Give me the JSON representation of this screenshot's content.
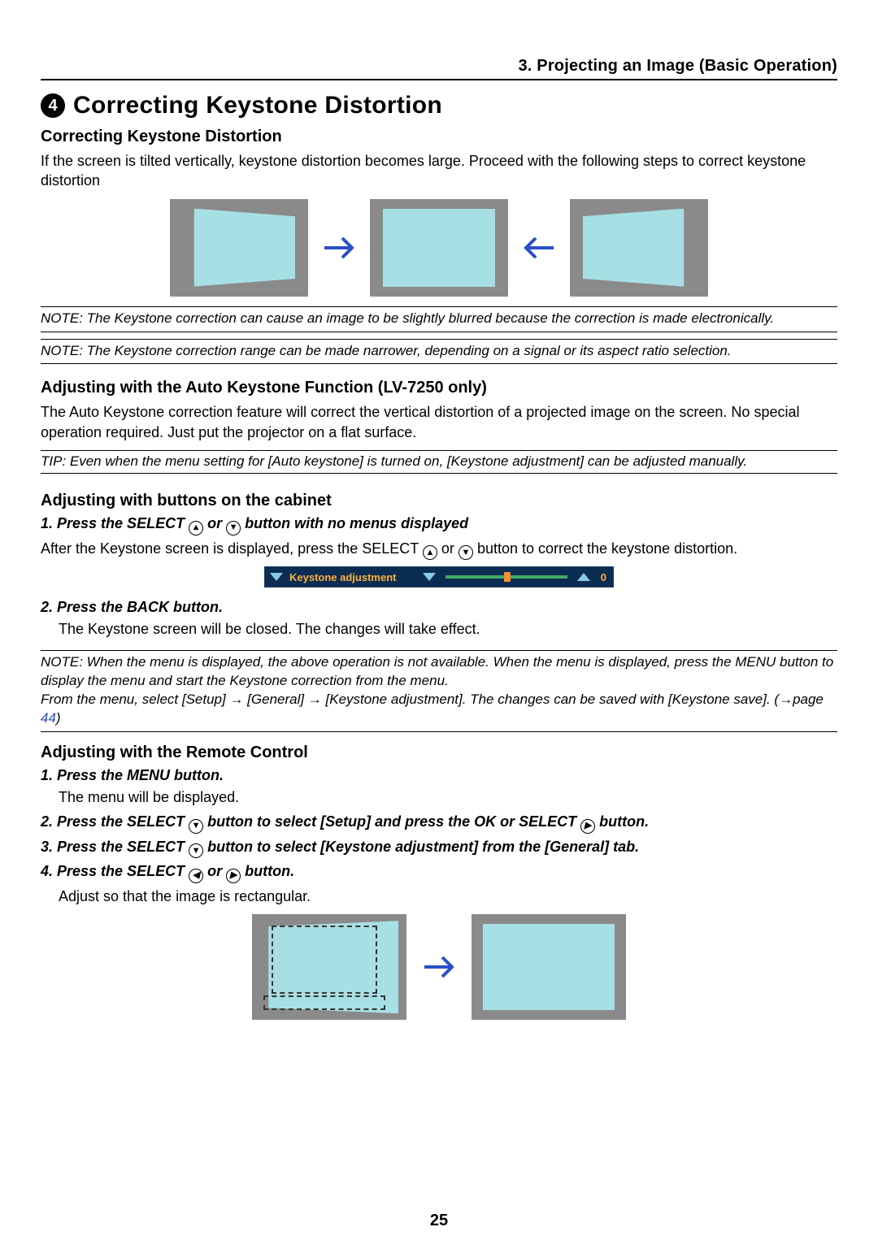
{
  "chapter": "3. Projecting an Image (Basic Operation)",
  "section_number": "4",
  "h1": "Correcting Keystone Distortion",
  "h2_a": "Correcting Keystone Distortion",
  "intro": "If the screen is tilted vertically, keystone distortion becomes large. Proceed with the following steps to correct keystone distortion",
  "note1": "NOTE: The Keystone correction can cause an image to be slightly blurred because the correction is made electronically.",
  "note2": "NOTE: The Keystone correction range can be made narrower, depending on a signal or its aspect ratio selection.",
  "h2_b": "Adjusting with the Auto Keystone Function (LV-7250 only)",
  "auto_body": "The Auto Keystone correction feature will correct the vertical distortion of a projected image on the screen. No special operation required. Just put the projector on a flat surface.",
  "tip1": "TIP: Even when the menu setting for [Auto keystone] is turned on, [Keystone adjustment] can be adjusted manually.",
  "h2_c": "Adjusting with buttons on the cabinet",
  "step1_pre": "1.  Press the SELECT ",
  "step1_mid": " or ",
  "step1_post": " button with no menus displayed",
  "after_pre": "After the Keystone screen is displayed, press the SELECT ",
  "after_mid": " or ",
  "after_post": " button to correct the keystone distortion.",
  "step2": "2.  Press the BACK button.",
  "step2_body": "The Keystone screen will be closed. The changes will take effect.",
  "note3_a": "NOTE: When the menu is displayed, the above operation is not available. When the menu is displayed, press the MENU button to display the menu and start the Keystone correction from the menu.",
  "note3_b_pre": "From the menu, select [Setup] → [General] → [Keystone adjustment]. The changes can be saved with [Keystone save]. (→page ",
  "note3_link": "44",
  "note3_b_post": ")",
  "h2_d": "Adjusting with the Remote Control",
  "rc1": "1.  Press the MENU button.",
  "rc1_body": "The menu will be displayed.",
  "rc2_pre": "2.  Press the SELECT ",
  "rc2_post": " button to select [Setup] and press the OK or SELECT ",
  "rc2_tail": " button.",
  "rc3_pre": "3.  Press the SELECT ",
  "rc3_post": " button to select [Keystone adjustment] from the [General] tab.",
  "rc4_pre": "4.  Press the SELECT ",
  "rc4_mid": " or ",
  "rc4_post": " button.",
  "rc4_body": "Adjust so that the image is rectangular.",
  "osd": {
    "label": "Keystone adjustment",
    "value": "0"
  },
  "page_number": "25"
}
